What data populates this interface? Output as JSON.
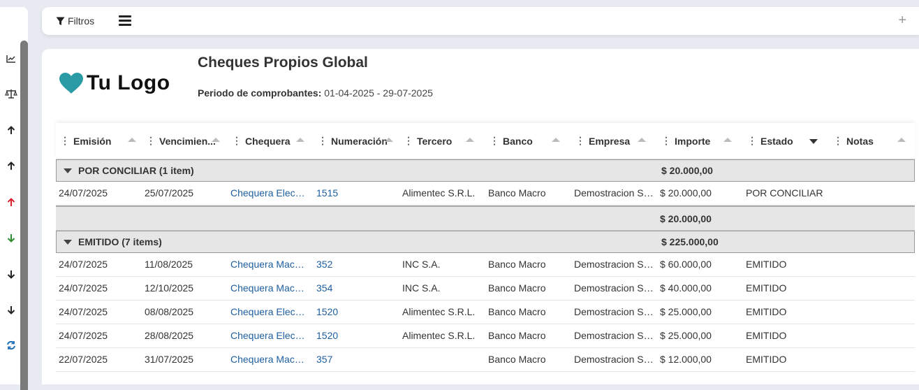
{
  "rail": {
    "icons": [
      "line-chart-icon",
      "balance-scale-icon",
      "arrow-up-icon",
      "arrow-up-icon",
      "arrow-up-red-icon",
      "arrow-down-green-icon",
      "arrow-down-icon",
      "arrow-down-icon",
      "refresh-icon"
    ],
    "colors": {
      "red": "#d9232d",
      "green": "#2e8b2e",
      "blue": "#1f6fb8"
    }
  },
  "toolbar": {
    "filter_label": "Filtros",
    "menu_icon": "hamburger-icon",
    "add_icon": "plus-icon",
    "plus": "+"
  },
  "header": {
    "logo_text": "Tu Logo",
    "logo_color": "#2a9ba5",
    "title": "Cheques Propios Global",
    "period_label": "Periodo de comprobantes:",
    "period_value": "01-04-2025 - 29-07-2025"
  },
  "columns": [
    "Emisión",
    "Vencimien...",
    "Chequera",
    "Numeración",
    "Tercero",
    "Banco",
    "Empresa",
    "Importe",
    "Estado",
    "Notas"
  ],
  "groups": [
    {
      "label": "POR CONCILIAR (1 item)",
      "total": "$ 20.000,00",
      "rows": [
        {
          "emision": "24/07/2025",
          "vencimiento": "25/07/2025",
          "chequera": "Chequera Electronica",
          "numeracion": "1515",
          "tercero": "Alimentec S.R.L.",
          "banco": "Banco Macro",
          "empresa": "Demostracion S.A.",
          "importe": "$ 20.000,00",
          "estado": "POR CONCILIAR"
        }
      ],
      "subtotal": "$ 20.000,00"
    },
    {
      "label": "EMITIDO (7 items)",
      "total": "$ 225.000,00",
      "rows": [
        {
          "emision": "24/07/2025",
          "vencimiento": "11/08/2025",
          "chequera": "Chequera Macro Fisica",
          "numeracion": "352",
          "tercero": "INC S.A.",
          "banco": "Banco Macro",
          "empresa": "Demostracion S.A.",
          "importe": "$ 60.000,00",
          "estado": "EMITIDO"
        },
        {
          "emision": "24/07/2025",
          "vencimiento": "12/10/2025",
          "chequera": "Chequera Macro Fisica",
          "numeracion": "354",
          "tercero": "INC S.A.",
          "banco": "Banco Macro",
          "empresa": "Demostracion S.A.",
          "importe": "$ 40.000,00",
          "estado": "EMITIDO"
        },
        {
          "emision": "24/07/2025",
          "vencimiento": "08/08/2025",
          "chequera": "Chequera Electronica",
          "numeracion": "1520",
          "tercero": "Alimentec S.R.L.",
          "banco": "Banco Macro",
          "empresa": "Demostracion S.A.",
          "importe": "$ 25.000,00",
          "estado": "EMITIDO"
        },
        {
          "emision": "24/07/2025",
          "vencimiento": "28/08/2025",
          "chequera": "Chequera Electronica",
          "numeracion": "1520",
          "tercero": "Alimentec S.R.L.",
          "banco": "Banco Macro",
          "empresa": "Demostracion S.A.",
          "importe": "$ 25.000,00",
          "estado": "EMITIDO"
        },
        {
          "emision": "22/07/2025",
          "vencimiento": "31/07/2025",
          "chequera": "Chequera Macro Fisica",
          "numeracion": "357",
          "tercero": "",
          "banco": "Banco Macro",
          "empresa": "Demostracion S.A.",
          "importe": "$ 12.000,00",
          "estado": "EMITIDO"
        }
      ]
    }
  ]
}
